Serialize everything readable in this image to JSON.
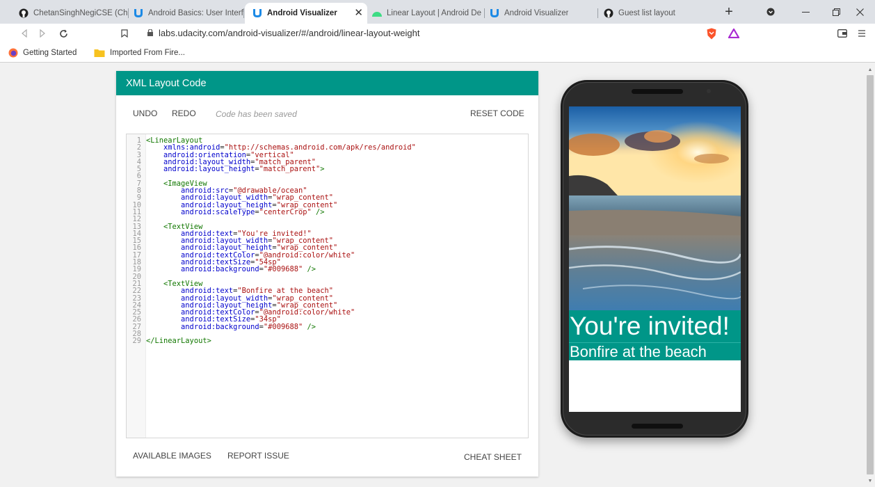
{
  "browser": {
    "tabs": [
      {
        "label": "ChetanSinghNegiCSE (Cheta",
        "icon": "github-icon"
      },
      {
        "label": "Android Basics: User Interfa",
        "icon": "udacity-icon"
      },
      {
        "label": "Android Visualizer",
        "icon": "udacity-icon",
        "active": true
      },
      {
        "label": "Linear Layout | Android De",
        "icon": "android-icon"
      },
      {
        "label": "Android Visualizer",
        "icon": "udacity-icon"
      },
      {
        "label": "Guest list layout",
        "icon": "github-icon"
      }
    ],
    "close_tab_glyph": "✕",
    "new_tab_glyph": "+",
    "url": "labs.udacity.com/android-visualizer/#/android/linear-layout-weight",
    "bookmarks": [
      {
        "label": "Getting Started",
        "icon": "firefox-icon"
      },
      {
        "label": "Imported From Fire...",
        "icon": "folder-icon"
      }
    ]
  },
  "editor": {
    "header_title": "XML Layout Code",
    "undo_label": "UNDO",
    "redo_label": "REDO",
    "saved_status": "Code has been saved",
    "reset_label": "RESET CODE",
    "available_images_label": "AVAILABLE IMAGES",
    "report_issue_label": "REPORT ISSUE",
    "cheat_sheet_label": "CHEAT SHEET",
    "code_lines": [
      "<LinearLayout",
      "    xmlns:android=\"http://schemas.android.com/apk/res/android\"",
      "    android:orientation=\"vertical\"",
      "    android:layout_width=\"match_parent\"",
      "    android:layout_height=\"match_parent\">",
      "",
      "    <ImageView",
      "        android:src=\"@drawable/ocean\"",
      "        android:layout_width=\"wrap_content\"",
      "        android:layout_height=\"wrap_content\"",
      "        android:scaleType=\"centerCrop\" />",
      "",
      "    <TextView",
      "        android:text=\"You're invited!\"",
      "        android:layout_width=\"wrap_content\"",
      "        android:layout_height=\"wrap_content\"",
      "        android:textColor=\"@android:color/white\"",
      "        android:textSize=\"54sp\"",
      "        android:background=\"#009688\" />",
      "",
      "    <TextView",
      "        android:text=\"Bonfire at the beach\"",
      "        android:layout_width=\"wrap_content\"",
      "        android:layout_height=\"wrap_content\"",
      "        android:textColor=\"@android:color/white\"",
      "        android:textSize=\"34sp\"",
      "        android:background=\"#009688\" />",
      "",
      "</LinearLayout>"
    ]
  },
  "preview": {
    "title_text": "You're invited!",
    "subtitle_text": "Bonfire at the beach"
  },
  "colors": {
    "accent": "#009688",
    "tag": "#117700",
    "attribute": "#0000cc",
    "string": "#aa1111"
  }
}
